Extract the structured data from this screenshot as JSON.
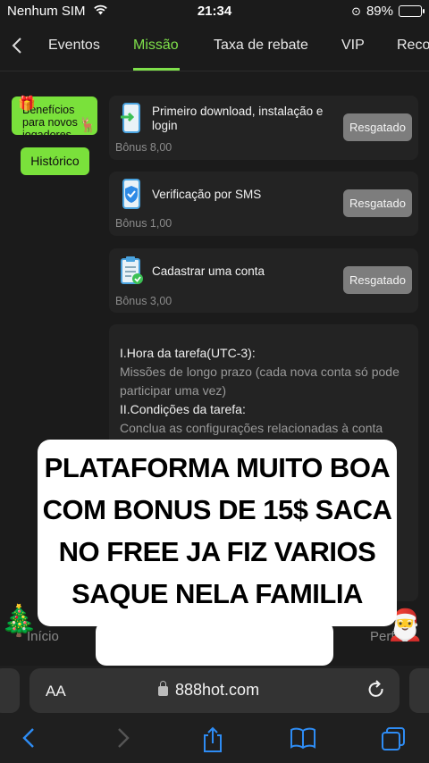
{
  "status_bar": {
    "carrier": "Nenhum SIM",
    "wifi_icon": "wifi-icon",
    "time": "21:34",
    "battery_percent": "89%",
    "battery_level": 0.89
  },
  "tabs": {
    "items": [
      {
        "label": "Eventos"
      },
      {
        "label": "Missão"
      },
      {
        "label": "Taxa de rebate"
      },
      {
        "label": "VIP"
      },
      {
        "label": "Reco"
      }
    ],
    "active_index": 1,
    "accent_color": "#7fe04b"
  },
  "side_nav": {
    "benefits_label": "Benefícios para novos jogadores",
    "history_label": "Histórico"
  },
  "tasks": [
    {
      "title": "Primeiro download, instalação e login",
      "bonus": "Bônus 8,00",
      "button": "Resgatado",
      "icon": "phone-download-icon"
    },
    {
      "title": "Verificação por SMS",
      "bonus": "Bônus 1,00",
      "button": "Resgatado",
      "icon": "shield-check-icon"
    },
    {
      "title": "Cadastrar uma conta",
      "bonus": "Bônus 3,00",
      "button": "Resgatado",
      "icon": "clipboard-check-icon"
    }
  ],
  "info": {
    "section1_title": "I.Hora da tarefa(UTC-3):",
    "section1_text": "Missões de longo prazo (cada nova conta só pode participar uma vez)",
    "section2_title": "II.Condições da tarefa:",
    "section2_text": "Conclua as configurações relacionadas à conta"
  },
  "bottom_nav": {
    "home_label": "Início",
    "profile_label": "Perfil"
  },
  "caption": {
    "text": "PLATAFORMA MUITO BOA COM BONUS DE 15$ SACA NO FREE JA FIZ VARIOS SAQUE NELA FAMILIA"
  },
  "browser": {
    "aa_label": "AA",
    "url": "888hot.com"
  }
}
